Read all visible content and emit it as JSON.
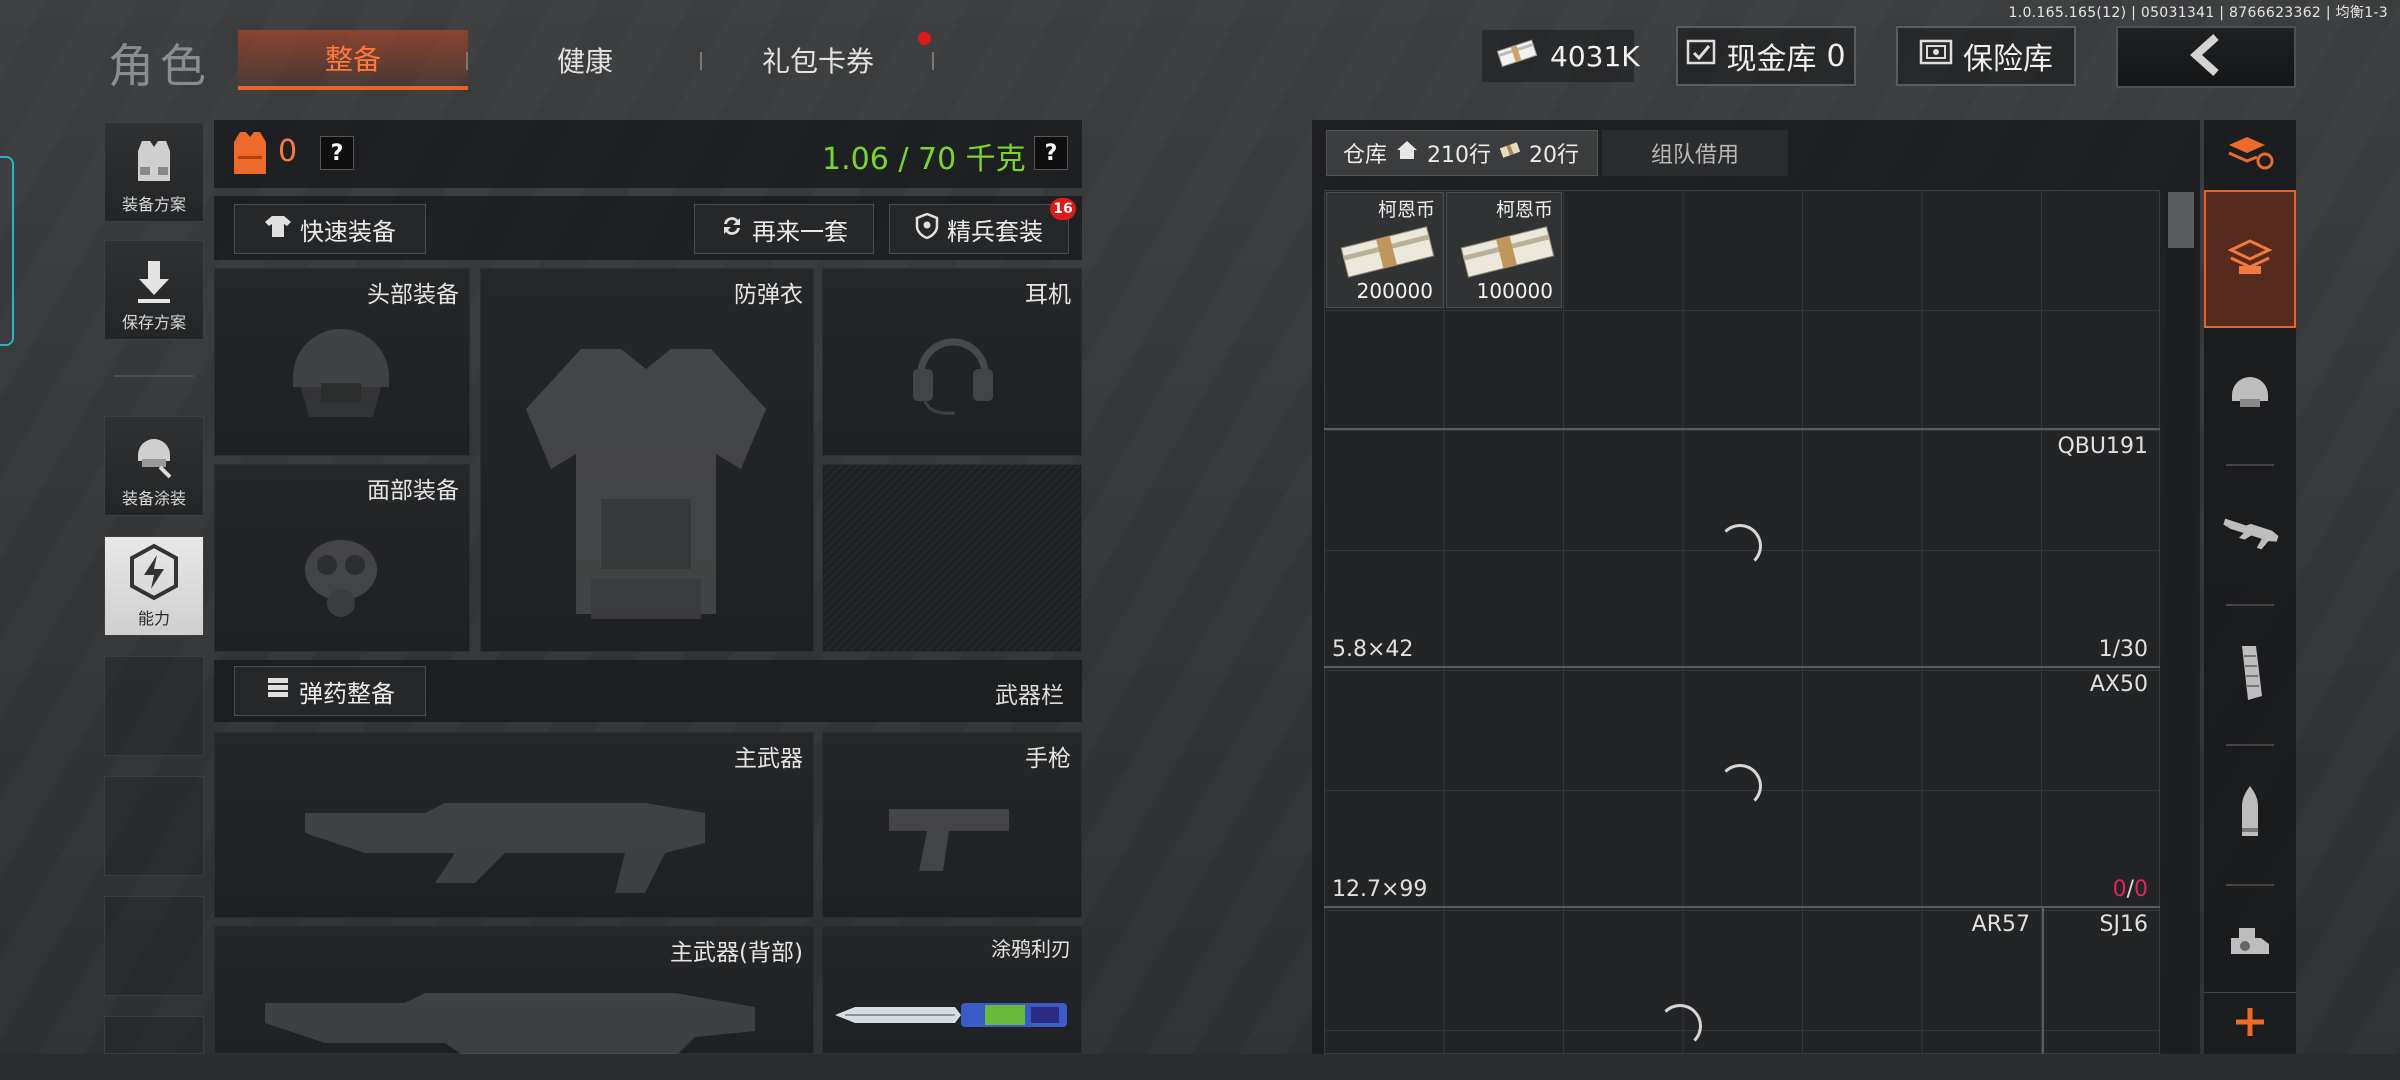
{
  "build_info": "1.0.165.165(12) | 05031341 | 8766623362 | 均衡1-3",
  "page_title": "角色",
  "tabs": [
    {
      "label": "整备",
      "active": true
    },
    {
      "label": "健康",
      "active": false
    },
    {
      "label": "礼包卡券",
      "active": false,
      "has_notification": true
    }
  ],
  "header": {
    "cash": "4031K",
    "cash_vault_label": "现金库",
    "cash_vault_value": "0",
    "safe_label": "保险库"
  },
  "left_sidebar": {
    "items": [
      {
        "label": "装备方案",
        "icon": "vest-plan-icon"
      },
      {
        "label": "保存方案",
        "icon": "download-icon"
      },
      {
        "label": "装备涂装",
        "icon": "helmet-paint-icon"
      },
      {
        "label": "能力",
        "icon": "ability-icon",
        "selected": true
      }
    ]
  },
  "loadout": {
    "vest_count": "0",
    "weight": "1.06 / 70 千克",
    "quick_equip_label": "快速装备",
    "again_label": "再来一套",
    "elite_label": "精兵套装",
    "elite_badge": "16",
    "slots": {
      "head": "头部装备",
      "armor": "防弹衣",
      "headset": "耳机",
      "face": "面部装备"
    },
    "ammo_label": "弹药整备",
    "weapon_bar_label": "武器栏",
    "weapons": {
      "primary": "主武器",
      "pistol": "手枪",
      "primary_back": "主武器(背部)",
      "knife": "涂鸦利刃"
    }
  },
  "warehouse": {
    "label": "仓库",
    "rows": "210行",
    "extra_rows": "20行",
    "team_borrow_label": "组队借用",
    "items": [
      {
        "name": "柯恩币",
        "count": "200000"
      },
      {
        "name": "柯恩币",
        "count": "100000"
      }
    ],
    "weapon_groups": [
      {
        "name": "QBU191",
        "caliber": "5.8×42",
        "ammo_current": "1",
        "ammo_max": "30"
      },
      {
        "name": "AX50",
        "caliber": "12.7×99",
        "ammo_current": "0",
        "ammo_max": "0"
      },
      {
        "name": "AR57",
        "caliber": "",
        "ammo_current": "",
        "ammo_max": ""
      },
      {
        "name": "SJ16",
        "caliber": "",
        "ammo_current": "",
        "ammo_max": ""
      }
    ]
  },
  "right_sidebar": {
    "icons": [
      "sort-refresh-icon",
      "all-items-icon",
      "helmet-icon",
      "rifle-icon",
      "magazine-icon",
      "ammo-icon",
      "attachment-icon",
      "add-icon"
    ]
  },
  "colors": {
    "accent": "#e8622a",
    "weight_green": "#7bd62a",
    "badge_red": "#e01818",
    "empty_ammo": "#e0245e"
  }
}
